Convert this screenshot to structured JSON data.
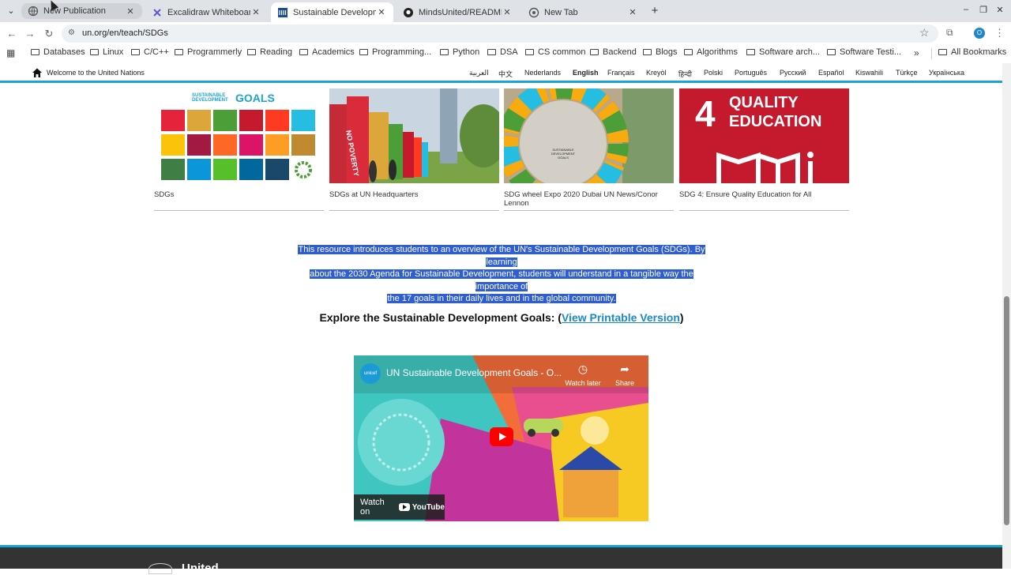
{
  "browser": {
    "tabs": [
      {
        "title": "New Publication",
        "icon": "globe-icon"
      },
      {
        "title": "Excalidraw Whiteboard",
        "icon": "excalidraw-icon"
      },
      {
        "title": "Sustainable Developmen",
        "icon": "un-icon"
      },
      {
        "title": "MindsUnited/README.m",
        "icon": "github-icon"
      },
      {
        "title": "New Tab",
        "icon": "chrome-icon"
      }
    ],
    "url": "un.org/en/teach/SDGs",
    "profile_initial": "O",
    "bookmarks": [
      "Databases",
      "Linux",
      "C/C++",
      "Programmerly",
      "Reading",
      "Academics",
      "Programming...",
      "Python",
      "DSA",
      "CS common",
      "Backend",
      "Blogs",
      "Algorithms",
      "Software arch...",
      "Software Testi..."
    ],
    "all_bookmarks": "All Bookmarks"
  },
  "un_bar": {
    "welcome": "Welcome to the United Nations",
    "languages": [
      "العربية",
      "中文",
      "Nederlands",
      "English",
      "Français",
      "Kreyòl",
      "हिन्दी",
      "Polski",
      "Português",
      "Русский",
      "Español",
      "Kiswahili",
      "Türkçe",
      "Українська"
    ]
  },
  "cards": [
    {
      "caption": "SDGs",
      "logo_small": "SUSTAINABLE DEVELOPMENT",
      "logo_big": "GOALS"
    },
    {
      "caption": "SDGs at UN Headquarters",
      "pillar_text": "NO POVERTY"
    },
    {
      "caption": "SDG wheel Expo 2020 Dubai UN News/Conor Lennon",
      "wheel_text": "SUSTAINABLE DEVELOPMENT GOALS"
    },
    {
      "caption": "SDG 4: Ensure Quality Education for All",
      "number": "4",
      "line1": "QUALITY",
      "line2": "EDUCATION"
    }
  ],
  "description": {
    "line1": "This resource introduces students to an overview of the UN's Sustainable Development Goals (SDGs). By learning",
    "line2": "about the 2030 Agenda for Sustainable Development, students will understand in a tangible way the importance of",
    "line3": "the 17 goals in their daily lives and in the global community."
  },
  "explore": {
    "prefix": "Explore the Sustainable Development Goals: (",
    "link": "View Printable Version",
    "suffix": ")"
  },
  "video": {
    "title": "UN Sustainable Development Goals - O...",
    "channel_logo": "unicef",
    "watch_later": "Watch later",
    "share": "Share",
    "watch_on": "Watch on",
    "youtube": "YouTube"
  },
  "footer": {
    "org": "United"
  },
  "colors": {
    "accent": "#1aa3d4",
    "highlight": "#2e5ed1",
    "link": "#1a8ac8",
    "sdg4": "#c5192d"
  }
}
